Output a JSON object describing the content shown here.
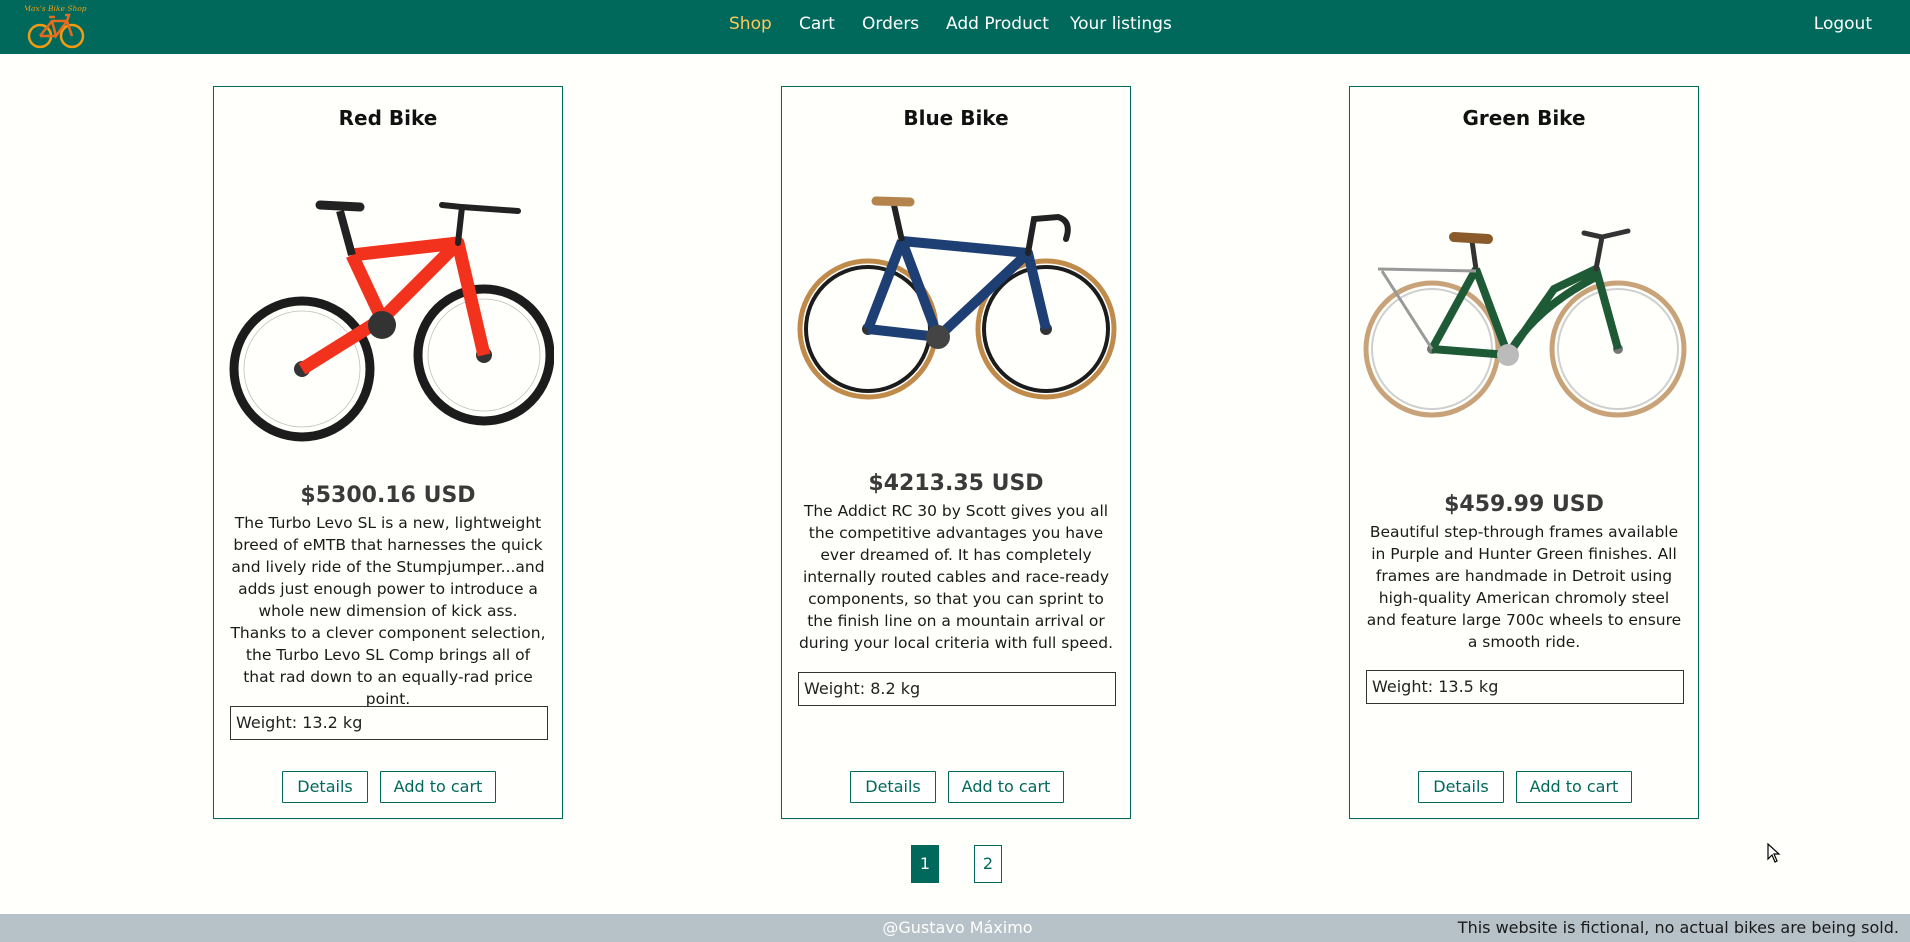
{
  "nav": {
    "logo_text": "Max's Bike Shop",
    "links": [
      {
        "label": "Shop",
        "active": true
      },
      {
        "label": "Cart",
        "active": false
      },
      {
        "label": "Orders",
        "active": false
      },
      {
        "label": "Add Product",
        "active": false
      },
      {
        "label": "Your listings",
        "active": false
      }
    ],
    "logout_label": "Logout"
  },
  "products": [
    {
      "title": "Red Bike",
      "image_icon": "red-mountain-bike",
      "price": "$5300.16 USD",
      "description": "The Turbo Levo SL is a new, lightweight breed of eMTB that harnesses the quick and lively ride of the Stumpjumper...and adds just enough power to introduce a whole new dimension of kick ass. Thanks to a clever component selection, the Turbo Levo SL Comp brings all of that rad down to an equally-rad price point.",
      "weight": "Weight: 13.2 kg",
      "details_label": "Details",
      "add_to_cart_label": "Add to cart"
    },
    {
      "title": "Blue Bike",
      "image_icon": "blue-road-bike",
      "price": "$4213.35 USD",
      "description": "The Addict RC 30 by Scott gives you all the competitive advantages you have ever dreamed of. It has completely internally routed cables and race-ready components, so that you can sprint to the finish line on a mountain arrival or during your local criteria with full speed.",
      "weight": "Weight: 8.2 kg",
      "details_label": "Details",
      "add_to_cart_label": "Add to cart"
    },
    {
      "title": "Green Bike",
      "image_icon": "green-city-bike",
      "price": "$459.99 USD",
      "description": "Beautiful step-through frames available in Purple and Hunter Green finishes. All frames are handmade in Detroit using high-quality American chromoly steel and feature large 700c wheels to ensure a smooth ride.",
      "weight": "Weight: 13.5 kg",
      "details_label": "Details",
      "add_to_cart_label": "Add to cart"
    }
  ],
  "pagination": {
    "pages": [
      "1",
      "2"
    ],
    "current": "1"
  },
  "footer": {
    "credit": "@Gustavo Máximo",
    "disclaimer": "This website is fictional, no actual bikes are being sold."
  },
  "colors": {
    "primary": "#00695c",
    "active_nav": "#ffc857",
    "footer_bg": "#b7c1c8"
  }
}
